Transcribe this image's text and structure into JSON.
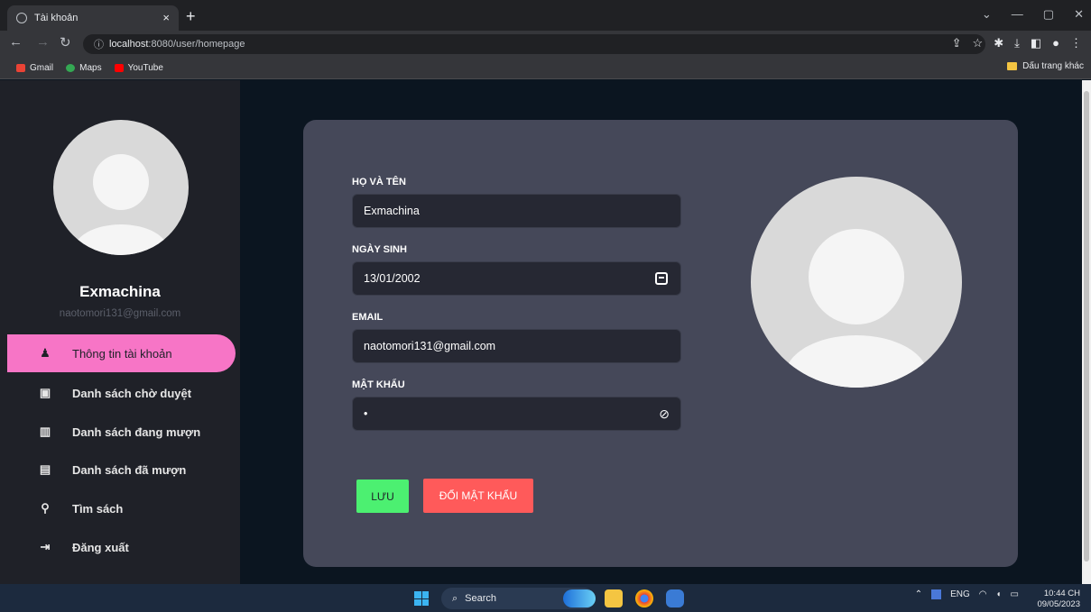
{
  "browser": {
    "tab_title": "Tài khoản",
    "tab_close": "×",
    "new_tab": "+",
    "url_host": "localhost",
    "url_rest": ":8080/user/homepage",
    "bookmarks": [
      {
        "label": "Gmail",
        "color": "#ea4335"
      },
      {
        "label": "Maps",
        "color": "#34a853"
      },
      {
        "label": "YouTube",
        "color": "#ff0000"
      }
    ],
    "other_bookmarks": "Dấu trang khác"
  },
  "sidebar": {
    "name": "Exmachina",
    "email": "naotomori131@gmail.com",
    "items": [
      {
        "label": "Thông tin tài khoản",
        "icon": "user-icon",
        "glyph": "👤",
        "active": true
      },
      {
        "label": "Danh sách chờ duyệt",
        "icon": "clipboard-icon",
        "glyph": "▣",
        "active": false
      },
      {
        "label": "Danh sách đang mượn",
        "icon": "book-open-icon",
        "glyph": "📖",
        "active": false
      },
      {
        "label": "Danh sách đã mượn",
        "icon": "book-icon",
        "glyph": "▤",
        "active": false
      },
      {
        "label": "Tìm sách",
        "icon": "search-icon",
        "glyph": "⌕",
        "active": false
      },
      {
        "label": "Đăng xuất",
        "icon": "logout-icon",
        "glyph": "⇥",
        "active": false
      }
    ]
  },
  "form": {
    "fullname_label": "HỌ VÀ TÊN",
    "fullname_value": "Exmachina",
    "dob_label": "NGÀY SINH",
    "dob_value": "13/01/2002",
    "email_label": "EMAIL",
    "email_value": "naotomori131@gmail.com",
    "password_label": "MẬT KHẨU",
    "password_value": "•",
    "save_label": "LƯU",
    "change_password_label": "ĐỔI MẬT KHẨU"
  },
  "colors": {
    "accent_pink": "#f775c6",
    "save_green": "#4cf071",
    "change_red": "#ff5a5a"
  },
  "taskbar": {
    "search_label": "Search",
    "lang": "ENG",
    "time": "10:44 CH",
    "date": "09/05/2023"
  }
}
